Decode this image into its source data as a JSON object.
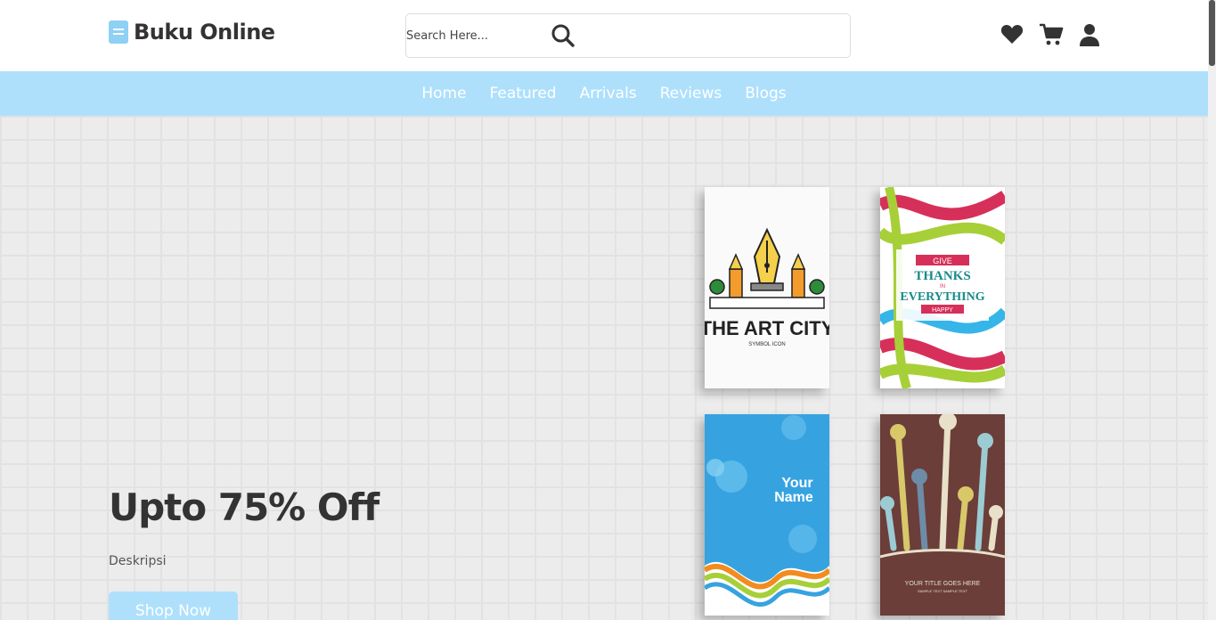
{
  "header": {
    "logo_text": "Buku Online",
    "search_placeholder": "Search Here..."
  },
  "nav": {
    "items": [
      "Home",
      "Featured",
      "Arrivals",
      "Reviews",
      "Blogs"
    ]
  },
  "hero": {
    "title": "Upto 75% Off",
    "description": "Deskripsi",
    "button_label": "Shop Now"
  },
  "books": [
    {
      "title": "THE ART CITY",
      "subtitle": "SYMBOL ICON"
    },
    {
      "line1": "GIVE",
      "line2": "THANKS",
      "line3": "IN",
      "line4": "EVERYTHING",
      "line5": "HAPPY"
    },
    {
      "line1": "Your",
      "line2": "Name"
    },
    {
      "line1": "YOUR TITLE GOES HERE",
      "line2": "SAMPLE TEXT SAMPLE TEXT"
    }
  ],
  "colors": {
    "nav_bg": "#aee0fc",
    "accent": "#8fd0f5",
    "text_dark": "#333333"
  }
}
